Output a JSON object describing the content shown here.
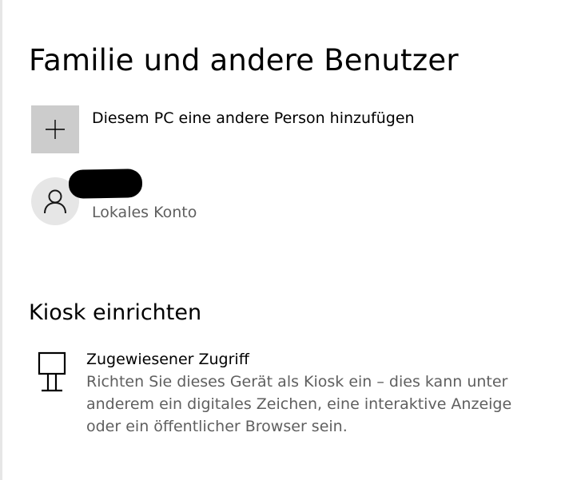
{
  "page": {
    "title": "Familie und andere Benutzer"
  },
  "add_person": {
    "label": "Diesem PC eine andere Person hinzufügen",
    "icon": "plus-icon"
  },
  "user": {
    "name": "",
    "type": "Lokales Konto",
    "icon": "person-icon"
  },
  "kiosk_section": {
    "title": "Kiosk einrichten",
    "item": {
      "title": "Zugewiesener Zugriff",
      "description": "Richten Sie dieses Gerät als Kiosk ein – dies kann unter anderem ein digitales Zeichen, eine interaktive Anzeige oder ein öffentlicher Browser sein.",
      "icon": "kiosk-icon"
    }
  },
  "colors": {
    "background": "#ffffff",
    "tile": "#cccccc",
    "avatar": "#e6e6e6",
    "secondary_text": "#5f5f5f"
  }
}
